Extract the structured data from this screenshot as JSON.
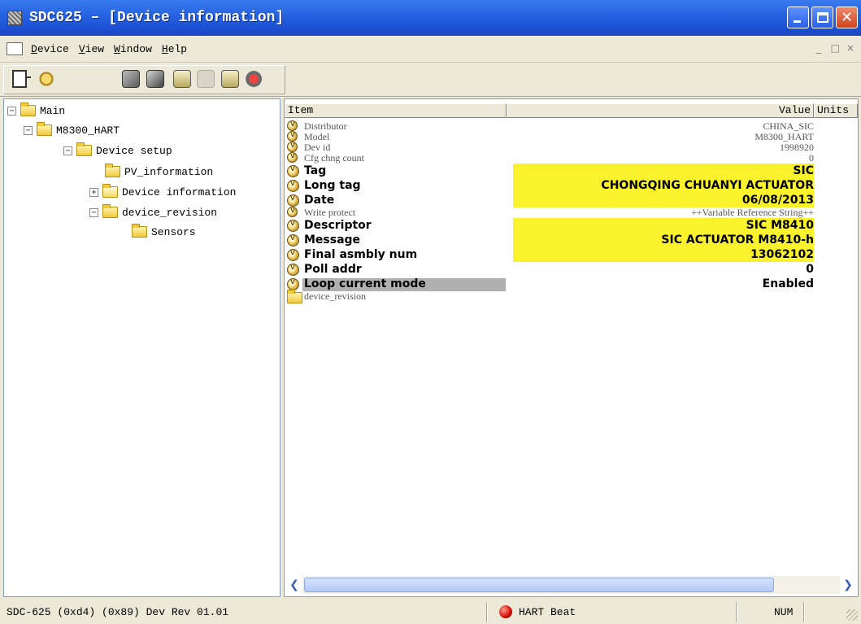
{
  "window": {
    "title": "SDC625 – [Device information]",
    "controls": [
      "minimize-icon",
      "maximize-icon",
      "close-icon"
    ]
  },
  "menu": {
    "items": [
      {
        "key": "D",
        "rest": "evice"
      },
      {
        "key": "V",
        "rest": "iew"
      },
      {
        "key": "W",
        "rest": "indow"
      },
      {
        "key": "H",
        "rest": "elp"
      }
    ],
    "mdi_controls": [
      "_",
      " □",
      "×"
    ]
  },
  "toolbar": {
    "icons": [
      "new-document-icon",
      "help-icon",
      "connect-device-icon",
      "disconnect-device-icon",
      "sync-icon",
      "offline-icon",
      "upload-icon",
      "close-device-icon"
    ]
  },
  "tree": {
    "nodes": [
      {
        "label": "Main",
        "expander": "−",
        "folder": "closed"
      },
      {
        "label": "M8300_HART",
        "expander": "−",
        "folder": "closed"
      },
      {
        "label": "Device setup",
        "expander": "−",
        "folder": "closed"
      },
      {
        "label": "PV_information",
        "expander": "",
        "folder": "closed"
      },
      {
        "label": "Device information",
        "expander": "+",
        "folder": "open"
      },
      {
        "label": "device_revision",
        "expander": "−",
        "folder": "closed"
      },
      {
        "label": "Sensors",
        "expander": "",
        "folder": "closed"
      }
    ]
  },
  "table": {
    "headers": {
      "item": "Item",
      "value": "Value",
      "units": "Units"
    },
    "rows": [
      {
        "label": "Distributor",
        "value": "CHINA_SIC",
        "style": "dim",
        "highlight": false
      },
      {
        "label": "Model",
        "value": "M8300_HART",
        "style": "dim",
        "highlight": false
      },
      {
        "label": "Dev id",
        "value": "1998920",
        "style": "dim",
        "highlight": false
      },
      {
        "label": "Cfg chng count",
        "value": "0",
        "style": "dim",
        "highlight": false
      },
      {
        "label": "Tag",
        "value": "SIC",
        "style": "bold",
        "highlight": true
      },
      {
        "label": "Long tag",
        "value": "CHONGQING CHUANYI ACTUATOR",
        "style": "bold",
        "highlight": true
      },
      {
        "label": "Date",
        "value": "06/08/2013",
        "style": "bold",
        "highlight": true
      },
      {
        "label": "Write protect",
        "value": "++Variable Reference String++",
        "style": "dim",
        "highlight": false
      },
      {
        "label": "Descriptor",
        "value": "SIC M8410",
        "style": "bold",
        "highlight": true
      },
      {
        "label": "Message",
        "value": "SIC ACTUATOR M8410-h",
        "style": "bold",
        "highlight": true
      },
      {
        "label": "Final asmbly num",
        "value": "13062102",
        "style": "bold",
        "highlight": true
      },
      {
        "label": "Poll addr",
        "value": "0",
        "style": "bold",
        "highlight": false
      },
      {
        "label": "Loop current mode",
        "value": "Enabled",
        "style": "bold",
        "highlight": false,
        "selected": true
      },
      {
        "label": "device_revision",
        "value": "",
        "style": "dim",
        "highlight": false,
        "folder": true
      }
    ]
  },
  "status": {
    "left": "SDC-625   (0xd4)   (0x89) Dev Rev 01.01",
    "heartbeat": "HART Beat",
    "num": "NUM"
  },
  "colors": {
    "titlebar": "#2561e0",
    "highlight": "#fbf22e",
    "heartbeat": "#d10a00"
  }
}
